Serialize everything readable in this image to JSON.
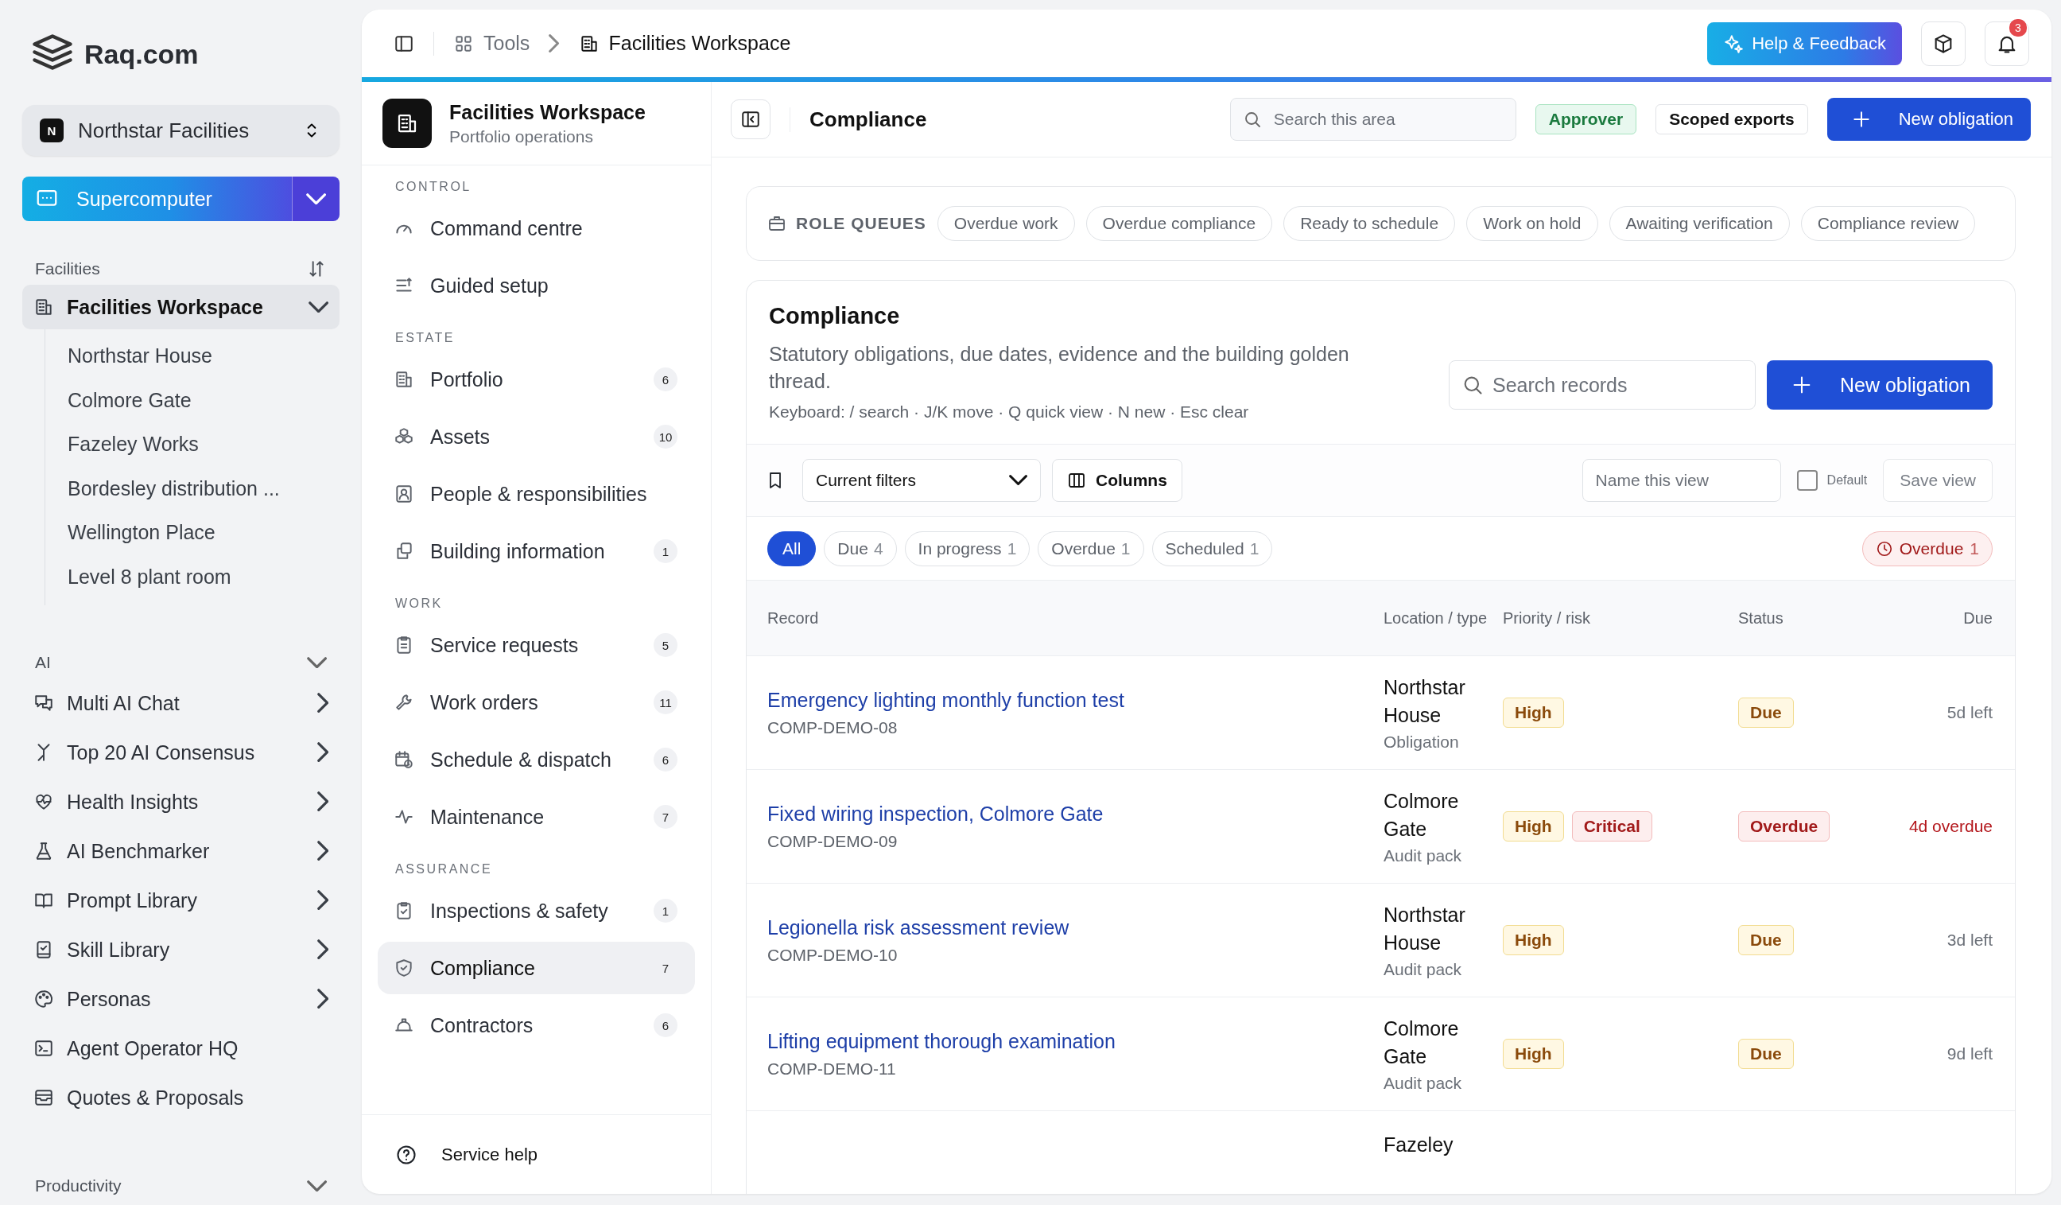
{
  "brand": {
    "name": "Raq.com"
  },
  "org_switcher": {
    "avatar": "N",
    "name": "Northstar Facilities"
  },
  "assistant_button": {
    "label": "Supercomputer"
  },
  "sidebar": {
    "sections": [
      {
        "title": "Facilities",
        "items": [
          {
            "label": "Facilities Workspace",
            "selected": true,
            "expanded": true,
            "children": [
              {
                "label": "Northstar House"
              },
              {
                "label": "Colmore Gate"
              },
              {
                "label": "Fazeley Works"
              },
              {
                "label": "Bordesley distribution ..."
              },
              {
                "label": "Wellington Place"
              },
              {
                "label": "Level 8 plant room"
              }
            ]
          }
        ]
      },
      {
        "title": "AI",
        "expanded": true,
        "items": [
          {
            "label": "Multi AI Chat",
            "selected": false,
            "submenu": true
          },
          {
            "label": "Top 20 AI Consensus",
            "selected": false,
            "submenu": true
          },
          {
            "label": "Health Insights",
            "selected": false,
            "submenu": true
          },
          {
            "label": "AI Benchmarker",
            "selected": false,
            "submenu": true
          },
          {
            "label": "Prompt Library",
            "selected": false,
            "submenu": true
          },
          {
            "label": "Skill Library",
            "selected": false,
            "submenu": true
          },
          {
            "label": "Personas",
            "selected": false,
            "submenu": true
          },
          {
            "label": "Agent Operator HQ",
            "selected": false,
            "submenu": false
          },
          {
            "label": "Quotes & Proposals",
            "selected": false,
            "submenu": false
          }
        ]
      },
      {
        "title": "Productivity",
        "expanded": true
      }
    ]
  },
  "top_bar": {
    "breadcrumbs": [
      {
        "label": "Tools",
        "current": false
      },
      {
        "label": "Facilities Workspace",
        "current": true
      }
    ],
    "help_button": "Help & Feedback",
    "notifications": "3"
  },
  "workspace_nav": {
    "title": "Facilities Workspace",
    "subtitle": "Portfolio operations",
    "sections": [
      {
        "title": "CONTROL",
        "items": [
          {
            "label": "Command centre",
            "selected": false
          },
          {
            "label": "Guided setup",
            "selected": false
          }
        ]
      },
      {
        "title": "ESTATE",
        "items": [
          {
            "label": "Portfolio",
            "count": "6",
            "selected": false
          },
          {
            "label": "Assets",
            "count": "10",
            "selected": false
          },
          {
            "label": "People & responsibilities",
            "selected": false
          },
          {
            "label": "Building information",
            "count": "1",
            "selected": false
          }
        ]
      },
      {
        "title": "WORK",
        "items": [
          {
            "label": "Service requests",
            "count": "5",
            "selected": false
          },
          {
            "label": "Work orders",
            "count": "11",
            "selected": false
          },
          {
            "label": "Schedule & dispatch",
            "count": "6",
            "selected": false
          },
          {
            "label": "Maintenance",
            "count": "7",
            "selected": false
          }
        ]
      },
      {
        "title": "ASSURANCE",
        "items": [
          {
            "label": "Inspections & safety",
            "count": "1",
            "selected": false
          },
          {
            "label": "Compliance",
            "count": "7",
            "selected": true
          },
          {
            "label": "Contractors",
            "count": "6",
            "selected": false
          }
        ]
      }
    ],
    "footer": "Service help"
  },
  "page_header": {
    "title": "Compliance",
    "search": {
      "placeholder": "Search this area"
    },
    "role_badge": "Approver",
    "scope_badge": "Scoped exports",
    "primary_button": "New obligation"
  },
  "role_queues": {
    "title": "ROLE QUEUES",
    "queues": [
      "Overdue work",
      "Overdue compliance",
      "Ready to schedule",
      "Work on hold",
      "Awaiting verification",
      "Compliance review"
    ]
  },
  "register": {
    "title": "Compliance",
    "description": "Statutory obligations, due dates, evidence and the building golden thread.",
    "shortcuts": "Keyboard: / search · J/K move · Q quick view · N new · Esc clear",
    "search": {
      "placeholder": "Search records"
    },
    "primary_button": "New obligation",
    "view_bar": {
      "saved_view": "Current filters",
      "columns_button": "Columns",
      "view_name": {
        "placeholder": "Name this view"
      },
      "default": {
        "label": "Default",
        "checked": false
      },
      "save_button": {
        "label": "Save view",
        "disabled": true
      }
    },
    "filters": [
      {
        "label": "All",
        "selected": true
      },
      {
        "label": "Due",
        "count": "4",
        "selected": false
      },
      {
        "label": "In progress",
        "count": "1",
        "selected": false
      },
      {
        "label": "Overdue",
        "count": "1",
        "selected": false
      },
      {
        "label": "Scheduled",
        "count": "1",
        "selected": false
      }
    ],
    "alert_chip": {
      "label": "Overdue",
      "count": "1"
    },
    "table": {
      "columns": [
        "Record",
        "Location / type",
        "Priority / risk",
        "Status",
        "Due"
      ],
      "rows": [
        {
          "title": "Emergency lighting monthly function test",
          "id": "COMP-DEMO-08",
          "location": "Northstar House",
          "type": "Obligation",
          "tags": [
            {
              "label": "High",
              "kind": "warning"
            }
          ],
          "status": {
            "label": "Due",
            "kind": "warning"
          },
          "due": "5d left",
          "overdue": false
        },
        {
          "title": "Fixed wiring inspection, Colmore Gate",
          "id": "COMP-DEMO-09",
          "location": "Colmore Gate",
          "type": "Audit pack",
          "tags": [
            {
              "label": "High",
              "kind": "warning"
            },
            {
              "label": "Critical",
              "kind": "danger"
            }
          ],
          "status": {
            "label": "Overdue",
            "kind": "danger"
          },
          "due": "4d overdue",
          "overdue": true
        },
        {
          "title": "Legionella risk assessment review",
          "id": "COMP-DEMO-10",
          "location": "Northstar House",
          "type": "Audit pack",
          "tags": [
            {
              "label": "High",
              "kind": "warning"
            }
          ],
          "status": {
            "label": "Due",
            "kind": "warning"
          },
          "due": "3d left",
          "overdue": false
        },
        {
          "title": "Lifting equipment thorough examination",
          "id": "COMP-DEMO-11",
          "location": "Colmore Gate",
          "type": "Audit pack",
          "tags": [
            {
              "label": "High",
              "kind": "warning"
            }
          ],
          "status": {
            "label": "Due",
            "kind": "warning"
          },
          "due": "9d left",
          "overdue": false
        }
      ],
      "partial_row": {
        "location": "Fazeley"
      }
    }
  }
}
